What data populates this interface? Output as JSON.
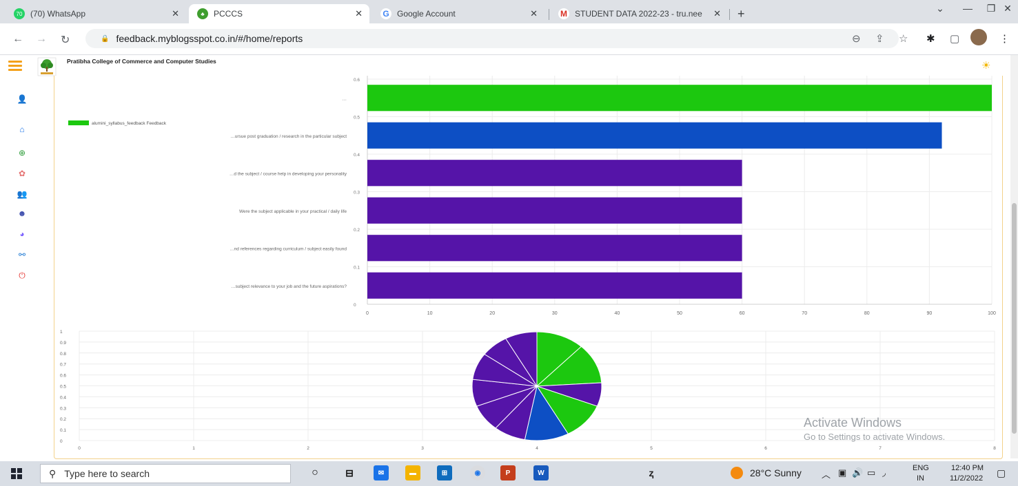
{
  "browser": {
    "tabs": [
      {
        "title": "(70) WhatsApp",
        "badge": "70",
        "active": false
      },
      {
        "title": "PCCCS",
        "active": true
      },
      {
        "title": "Google Account",
        "active": false
      },
      {
        "title": "STUDENT DATA 2022-23 - tru.nee",
        "active": false
      }
    ],
    "new_tab_label": "+",
    "url": "feedback.myblogsspot.co.in/#/home/reports"
  },
  "app": {
    "college_name": "Pratibha College of Commerce and Computer Studies"
  },
  "sidebar": {
    "items": [
      "user-icon",
      "home-icon",
      "add-circle-icon",
      "feedback-icon",
      "group-icon",
      "profile-icon",
      "chart-icon",
      "share-icon",
      "power-icon"
    ]
  },
  "chart_data": [
    {
      "type": "bar",
      "orientation": "horizontal",
      "legend": "alumini_syllabus_feedback Feedback",
      "categories": [
        "…",
        "…ursue post graduation / research in the particular subject",
        "…d the subject / course help in developing your personality",
        "Were the subject applicable in your practical / daily life",
        "…nd references regarding curriculum / subject easily found",
        "…subject relevance to your job and the future aspirations?"
      ],
      "values": [
        100,
        92,
        60,
        60,
        60,
        60
      ],
      "colors": [
        "#1cc80f",
        "#0d4fc4",
        "#5514a8",
        "#5514a8",
        "#5514a8",
        "#5514a8"
      ],
      "xlim": [
        0,
        100
      ],
      "xticks": [
        0,
        10,
        20,
        30,
        40,
        50,
        60,
        70,
        80,
        90,
        100
      ],
      "yticks": [
        "0",
        "0.1",
        "0.2",
        "0.3",
        "0.4",
        "0.5",
        "0.6"
      ],
      "grid": true
    },
    {
      "type": "pie",
      "values": [
        12,
        12,
        7,
        11,
        11,
        8,
        8,
        8,
        8,
        7,
        8
      ],
      "colors": [
        "#1cc80f",
        "#1cc80f",
        "#5514a8",
        "#1cc80f",
        "#0d4fc4",
        "#5514a8",
        "#5514a8",
        "#5514a8",
        "#5514a8",
        "#5514a8",
        "#5514a8"
      ],
      "yticks": [
        "0",
        "0.1",
        "0.2",
        "0.3",
        "0.4",
        "0.5",
        "0.6",
        "0.7",
        "0.8",
        "0.9",
        "1"
      ],
      "xticks": [
        "0",
        "1",
        "2",
        "3",
        "4",
        "5",
        "6",
        "7",
        "8"
      ],
      "grid": true
    }
  ],
  "watermark": {
    "line1": "Activate Windows",
    "line2": "Go to Settings to activate Windows."
  },
  "taskbar": {
    "search_placeholder": "Type here to search",
    "weather": "28°C  Sunny",
    "lang": "ENG",
    "region": "IN",
    "time": "12:40 PM",
    "date": "11/2/2022"
  }
}
